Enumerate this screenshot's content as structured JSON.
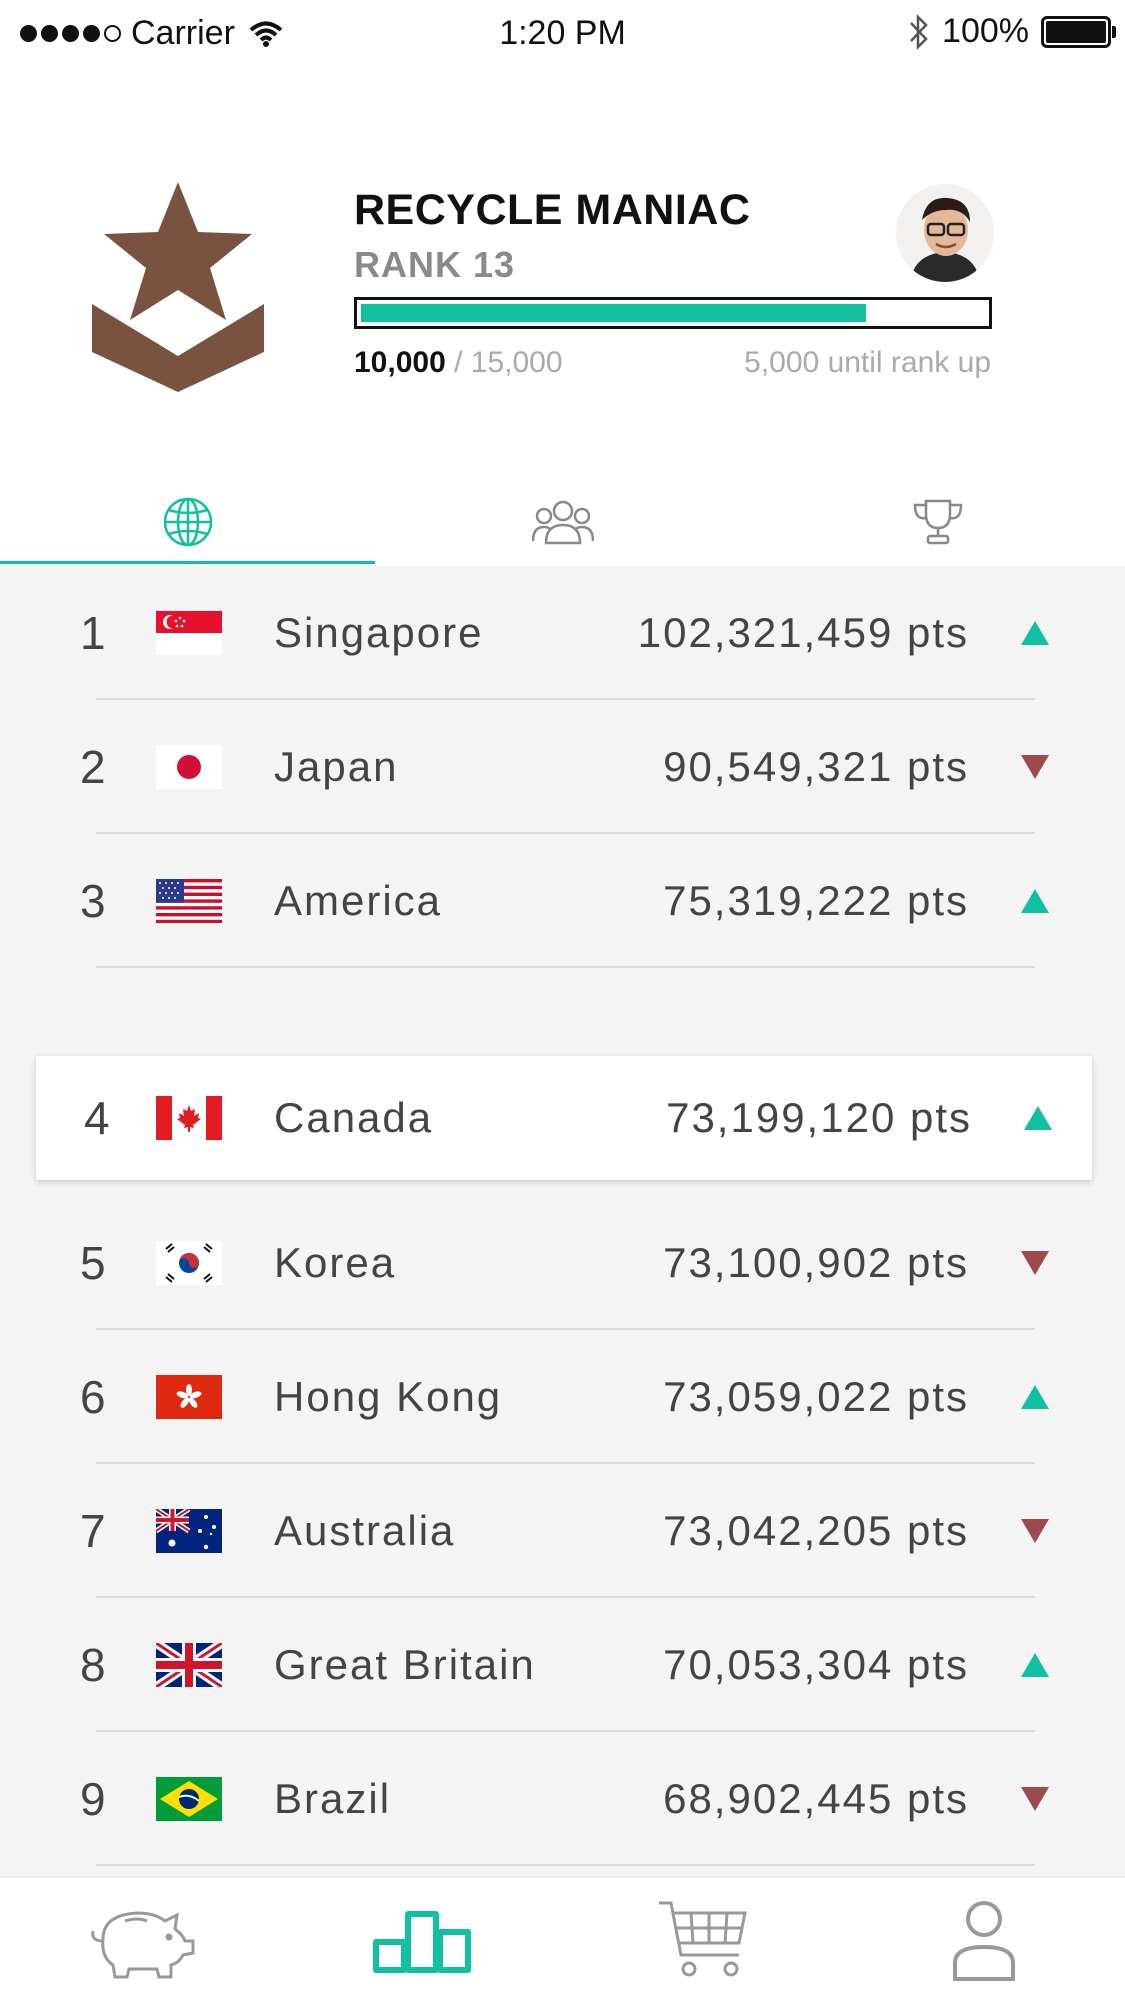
{
  "status_bar": {
    "carrier": "Carrier",
    "time": "1:20 PM",
    "battery": "100%",
    "signal_bars": 4,
    "battery_level": 1.0
  },
  "profile": {
    "title": "RECYCLE MANIAC",
    "rank": "RANK 13",
    "points_current": "10,000",
    "points_total": "/ 15,000",
    "until_rank_up": "5,000 until rank up",
    "progress_fraction": 0.81,
    "badge_color": "#7a5340",
    "accent_color": "#10c0a0"
  },
  "tabs": [
    {
      "icon": "globe-icon",
      "active": true
    },
    {
      "icon": "friends-icon",
      "active": false
    },
    {
      "icon": "trophy-icon",
      "active": false
    }
  ],
  "leaderboard": [
    {
      "rank": "1",
      "country": "Singapore",
      "score": "102,321,459 pts",
      "trend": "up",
      "flag": "singapore-flag"
    },
    {
      "rank": "2",
      "country": "Japan",
      "score": "90,549,321 pts",
      "trend": "down",
      "flag": "japan-flag"
    },
    {
      "rank": "3",
      "country": "America",
      "score": "75,319,222 pts",
      "trend": "up",
      "flag": "usa-flag"
    },
    {
      "rank": "4",
      "country": "Canada",
      "score": "73,199,120 pts",
      "trend": "up",
      "flag": "canada-flag",
      "highlighted": true
    },
    {
      "rank": "5",
      "country": "Korea",
      "score": "73,100,902 pts",
      "trend": "down",
      "flag": "korea-flag"
    },
    {
      "rank": "6",
      "country": "Hong Kong",
      "score": "73,059,022 pts",
      "trend": "up",
      "flag": "hong-kong-flag"
    },
    {
      "rank": "7",
      "country": "Australia",
      "score": "73,042,205 pts",
      "trend": "down",
      "flag": "australia-flag"
    },
    {
      "rank": "8",
      "country": "Great Britain",
      "score": "70,053,304 pts",
      "trend": "up",
      "flag": "great-britain-flag"
    },
    {
      "rank": "9",
      "country": "Brazil",
      "score": "68,902,445 pts",
      "trend": "down",
      "flag": "brazil-flag"
    }
  ],
  "trend_colors": {
    "up": "#10c0a0",
    "down": "#9c4a4e"
  },
  "bottom_nav": [
    {
      "icon": "piggy-bank-icon",
      "active": false
    },
    {
      "icon": "leaderboard-icon",
      "active": true
    },
    {
      "icon": "shopping-cart-icon",
      "active": false
    },
    {
      "icon": "profile-icon",
      "active": false
    }
  ]
}
